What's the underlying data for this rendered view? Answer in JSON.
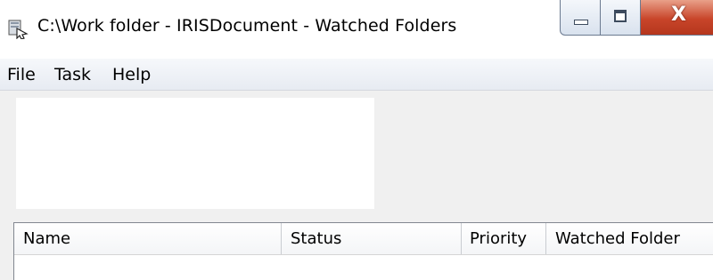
{
  "window": {
    "title": "C:\\Work folder -  IRISDocument - Watched Folders",
    "icon": "app-icon",
    "controls": {
      "minimize_icon": "minimize-icon",
      "maximize_icon": "maximize-icon",
      "close_label": "X"
    }
  },
  "menu": {
    "items": [
      "File",
      "Task",
      "Help"
    ]
  },
  "list": {
    "columns": [
      "Name",
      "Status",
      "Priority",
      "Watched Folder"
    ],
    "rows": []
  },
  "colors": {
    "close_button": "#c8452a",
    "menubar": "#e7ebf2",
    "client_background": "#f0f0f0"
  }
}
